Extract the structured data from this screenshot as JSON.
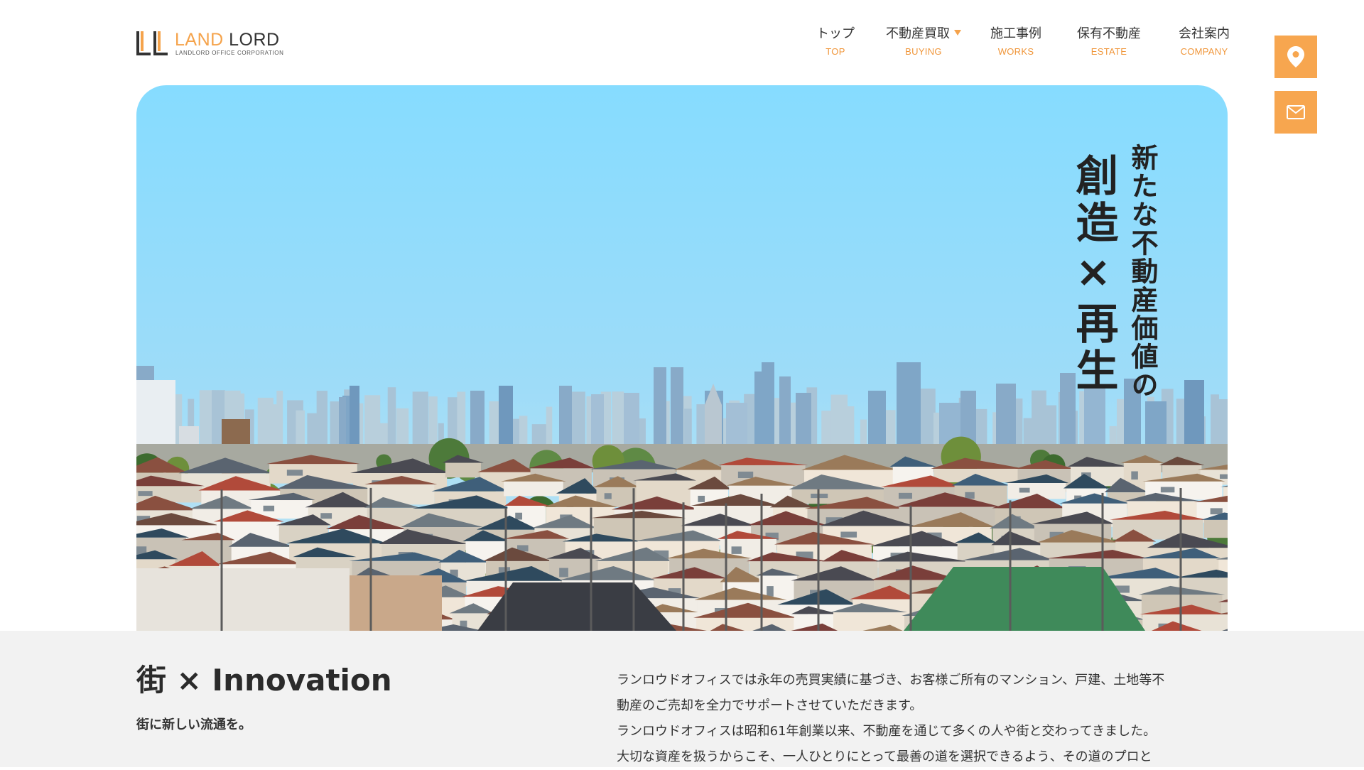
{
  "header": {
    "logo": {
      "mark": "LL",
      "word1": "LAND",
      "word2": "LORD",
      "sub": "LANDLORD OFFICE CORPORATION"
    },
    "nav": [
      {
        "jp": "トップ",
        "en": "TOP",
        "has_dropdown": false
      },
      {
        "jp": "不動産買取",
        "en": "BUYING",
        "has_dropdown": true
      },
      {
        "jp": "施工事例",
        "en": "WORKS",
        "has_dropdown": false
      },
      {
        "jp": "保有不動産",
        "en": "ESTATE",
        "has_dropdown": false
      },
      {
        "jp": "会社案内",
        "en": "COMPANY",
        "has_dropdown": false
      }
    ],
    "side_buttons": [
      {
        "icon": "map-pin-icon"
      },
      {
        "icon": "mail-icon"
      }
    ]
  },
  "hero": {
    "copy_small": "新たな不動産価値の",
    "copy_large": "創造×再生"
  },
  "intro": {
    "title": "街 × Innovation",
    "subtitle": "街に新しい流通を。",
    "body_lines": [
      "ランロウドオフィスでは永年の売買実績に基づき、お客様ご所有のマンション、戸建、土地等不",
      "動産のご売却を全力でサポートさせていただきます。",
      "ランロウドオフィスは昭和61年創業以来、不動産を通じて多くの人や街と交わってきました。",
      "大切な資産を扱うからこそ、一人ひとりにとって最善の道を選択できるよう、その道のプロと"
    ]
  },
  "colors": {
    "accent": "#f5a34b",
    "accent_text": "#f0963a",
    "sky_top": "#86dcff",
    "sky_bottom": "#bfe6f5",
    "band_bg": "#f2f2f2",
    "text": "#333333"
  }
}
